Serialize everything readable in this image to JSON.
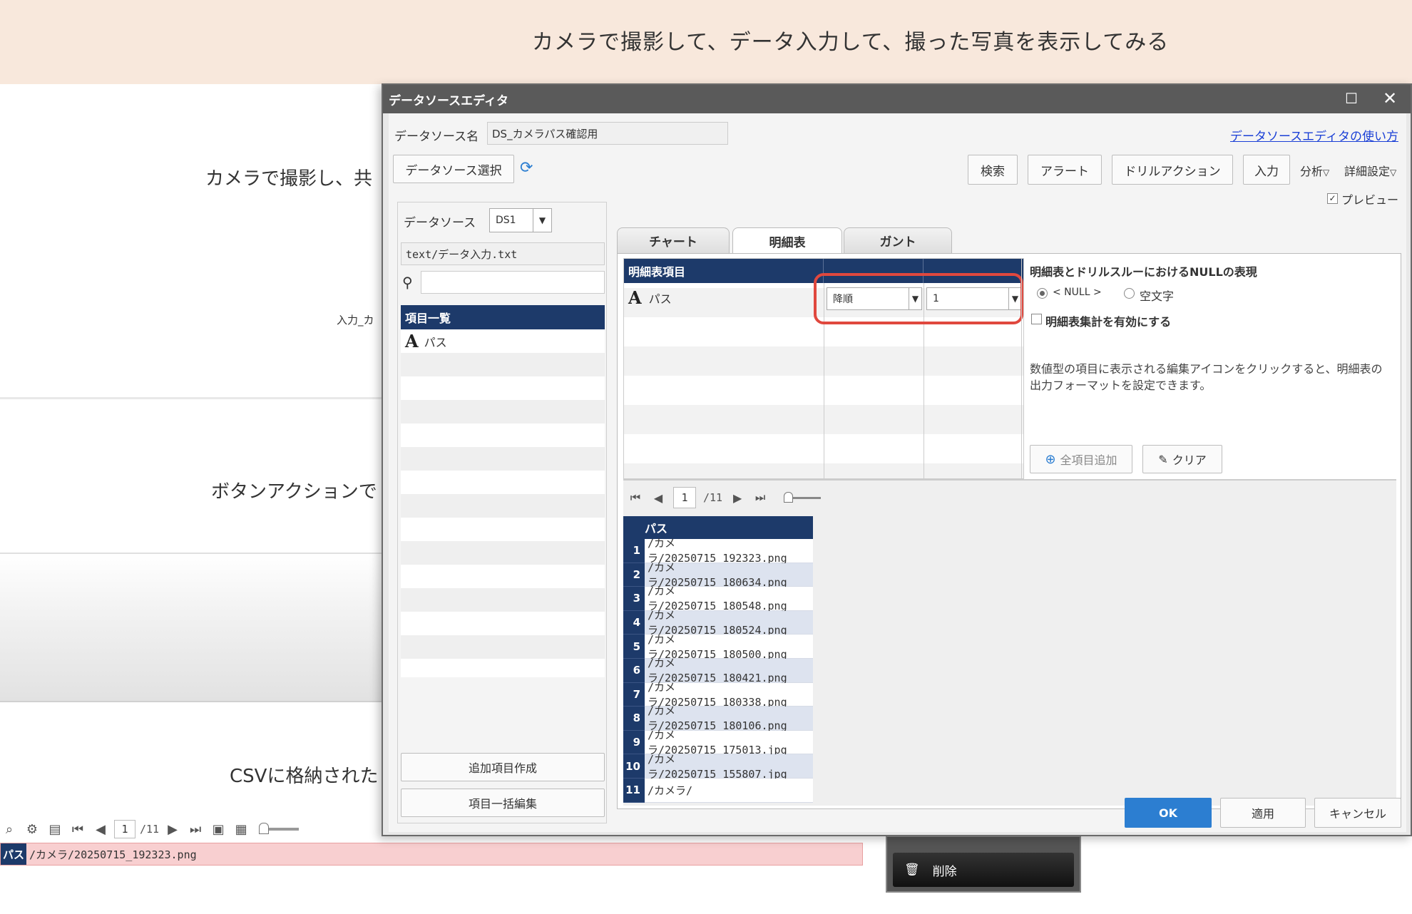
{
  "background": {
    "banner_title": "カメラで撮影して、データ入力して、撮った写真を表示してみる",
    "section1_text": "カメラで撮影し、共",
    "section1_small": "入力_カ",
    "section2_text": "ボタンアクションで",
    "section3_text": "CSVに格納された",
    "toolbar_page": "1",
    "toolbar_total": "/11",
    "result_label": "パス",
    "result_value": "/カメラ/20250715_192323.png",
    "delete_button": "削除"
  },
  "dialog": {
    "title": "データソースエディタ",
    "ds_name_label": "データソース名",
    "ds_name_value": "DS_カメラパス確認用",
    "help_link": "データソースエディタの使い方",
    "select_ds_button": "データソース選択",
    "toolbar_buttons": [
      "検索",
      "アラート",
      "ドリルアクション",
      "入力"
    ],
    "analysis_label": "分析",
    "detail_settings_label": "詳細設定",
    "preview_label": "プレビュー",
    "left": {
      "datasource_label": "データソース",
      "datasource_select": "DS1",
      "file_path": "text/データ入力.txt",
      "list_header": "項目一覧",
      "list_items": [
        "パス"
      ],
      "add_item_button": "追加項目作成",
      "bulk_edit_button": "項目一括編集"
    },
    "tabs": [
      "チャート",
      "明細表",
      "ガント"
    ],
    "active_tab": "明細表",
    "grid": {
      "header": "明細表項目",
      "row_item": "パス",
      "sort_value": "降順",
      "order_value": "1"
    },
    "options": {
      "null_title": "明細表とドリルスルーにおけるNULLの表現",
      "null_option": "< NULL >",
      "empty_option": "空文字",
      "aggregate_label": "明細表集計を有効にする",
      "description": "数値型の項目に表示される編集アイコンをクリックすると、明細表の出力フォーマットを設定できます。",
      "add_all_button": "全項目追加",
      "clear_button": "クリア"
    },
    "preview": {
      "page": "1",
      "total": "/11",
      "column_header": "パス",
      "rows": [
        "/カメラ/20250715_192323.png",
        "/カメラ/20250715_180634.png",
        "/カメラ/20250715_180548.png",
        "/カメラ/20250715_180524.png",
        "/カメラ/20250715_180500.png",
        "/カメラ/20250715_180421.png",
        "/カメラ/20250715_180338.png",
        "/カメラ/20250715_180106.png",
        "/カメラ/20250715_175013.jpg",
        "/カメラ/20250715_155807.jpg",
        "/カメラ/"
      ]
    },
    "footer": {
      "ok": "OK",
      "apply": "適用",
      "cancel": "キャンセル"
    }
  },
  "colors": {
    "banner": "#f8e8dc",
    "header_navy": "#1d3a6a",
    "ok_blue": "#2c7ed1",
    "highlight_red": "#e0483e"
  }
}
